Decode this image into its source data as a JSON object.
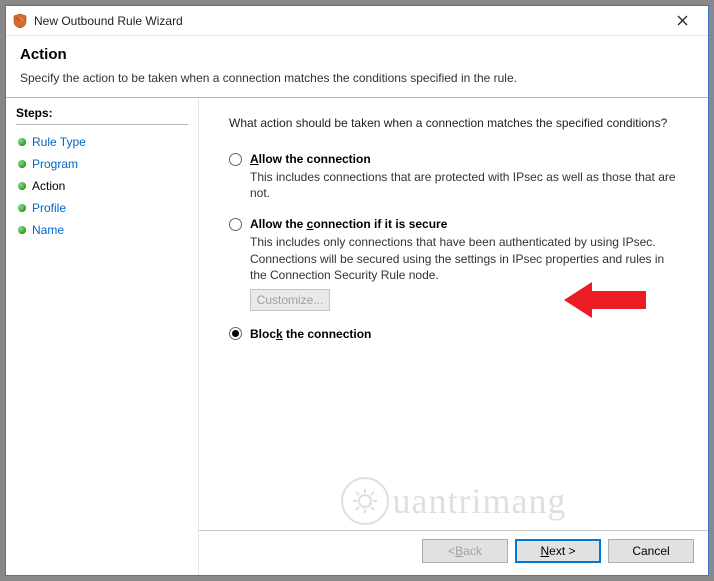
{
  "window": {
    "title": "New Outbound Rule Wizard"
  },
  "header": {
    "heading": "Action",
    "description": "Specify the action to be taken when a connection matches the conditions specified in the rule."
  },
  "steps": {
    "label": "Steps:",
    "items": [
      {
        "label": "Rule Type",
        "current": false
      },
      {
        "label": "Program",
        "current": false
      },
      {
        "label": "Action",
        "current": true
      },
      {
        "label": "Profile",
        "current": false
      },
      {
        "label": "Name",
        "current": false
      }
    ]
  },
  "content": {
    "prompt": "What action should be taken when a connection matches the specified conditions?",
    "options": [
      {
        "id": "allow",
        "label_pre": "",
        "underline": "A",
        "label_post": "llow the connection",
        "description": "This includes connections that are protected with IPsec as well as those that are not.",
        "selected": false
      },
      {
        "id": "allow-secure",
        "label_pre": "Allow the ",
        "underline": "c",
        "label_post": "onnection if it is secure",
        "description": "This includes only connections that have been authenticated by using IPsec. Connections will be secured using the settings in IPsec properties and rules in the Connection Security Rule node.",
        "selected": false
      },
      {
        "id": "block",
        "label_pre": "Bloc",
        "underline": "k",
        "label_post": " the connection",
        "description": "",
        "selected": true
      }
    ],
    "customize_label": "Customize..."
  },
  "buttons": {
    "back_pre": "< ",
    "back_ul": "B",
    "back_post": "ack",
    "next_ul": "N",
    "next_post": "ext >",
    "cancel": "Cancel"
  },
  "watermark": "uantrimang"
}
